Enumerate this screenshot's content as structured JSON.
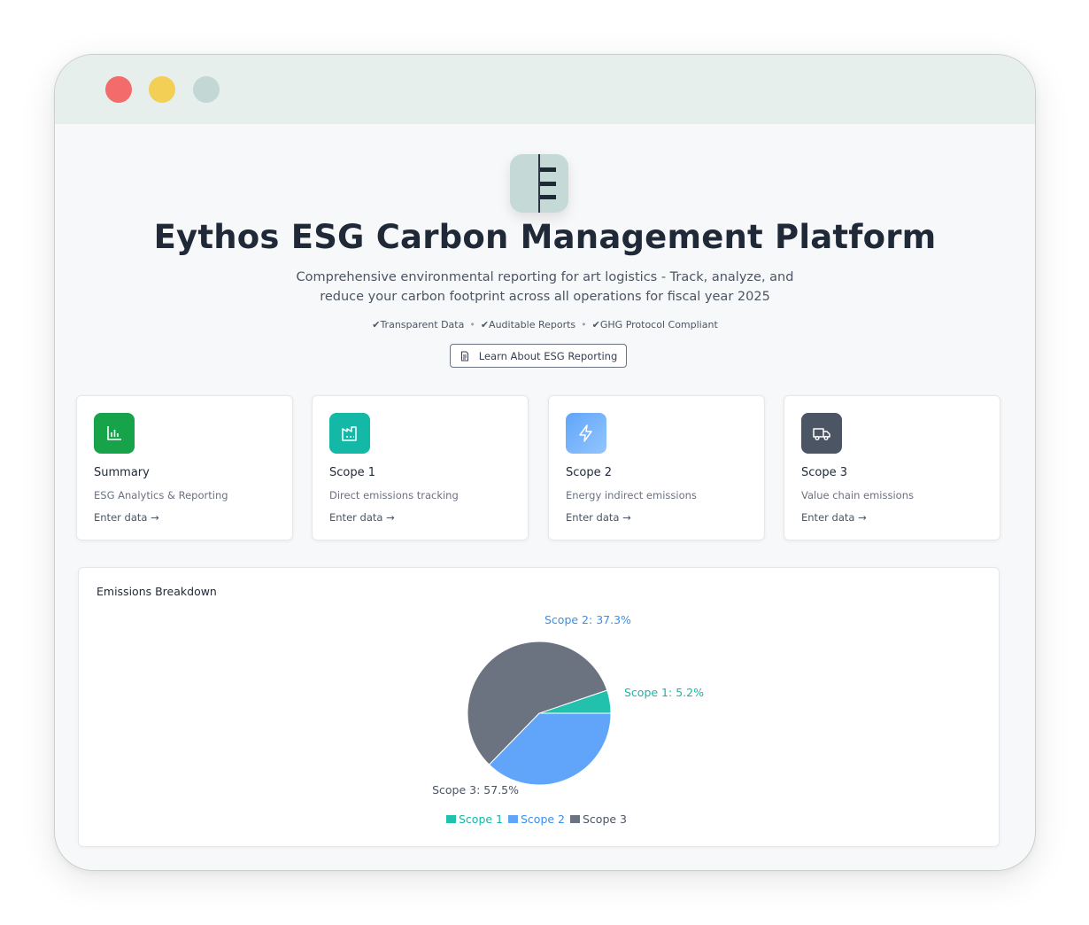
{
  "window": {
    "controls": [
      "close",
      "minimize",
      "maximize"
    ]
  },
  "hero": {
    "logo_icon": "eythos-logo-icon",
    "title": "Eythos ESG Carbon Management Platform",
    "subtitle": "Comprehensive environmental reporting for art logistics - Track, analyze, and reduce your carbon footprint across all operations for fiscal year 2025",
    "badges": [
      "✔Transparent Data",
      "✔Auditable Reports",
      "✔GHG Protocol Compliant"
    ],
    "learn_button": "Learn About ESG Reporting",
    "learn_button_icon": "document-icon"
  },
  "cards": [
    {
      "title": "Summary",
      "description": "ESG Analytics & Reporting",
      "link": "Enter data →",
      "icon": "bar-chart-icon",
      "color": "#16a34a"
    },
    {
      "title": "Scope 1",
      "description": "Direct emissions tracking",
      "link": "Enter data →",
      "icon": "factory-icon",
      "color": "#14b8a6"
    },
    {
      "title": "Scope 2",
      "description": "Energy indirect emissions",
      "link": "Enter data →",
      "icon": "lightning-icon",
      "color": "#60a5fa"
    },
    {
      "title": "Scope 3",
      "description": "Value chain emissions",
      "link": "Enter data →",
      "icon": "truck-icon",
      "color": "#4b5563"
    }
  ],
  "emissions_panel": {
    "title": "Emissions Breakdown"
  },
  "chart_data": {
    "type": "pie",
    "title": "Emissions Breakdown",
    "categories": [
      "Scope 1",
      "Scope 2",
      "Scope 3"
    ],
    "values": [
      5.2,
      37.3,
      57.5
    ],
    "labels": [
      "Scope 1: 5.2%",
      "Scope 2: 37.3%",
      "Scope 3: 57.5%"
    ],
    "colors": [
      "#22c1ad",
      "#60a5fa",
      "#6b7280"
    ],
    "label_colors": [
      "#14b8a6",
      "#3b8fe8",
      "#4b5563"
    ],
    "legend": [
      "Scope 1",
      "Scope 2",
      "Scope 3"
    ],
    "legend_position": "bottom"
  }
}
